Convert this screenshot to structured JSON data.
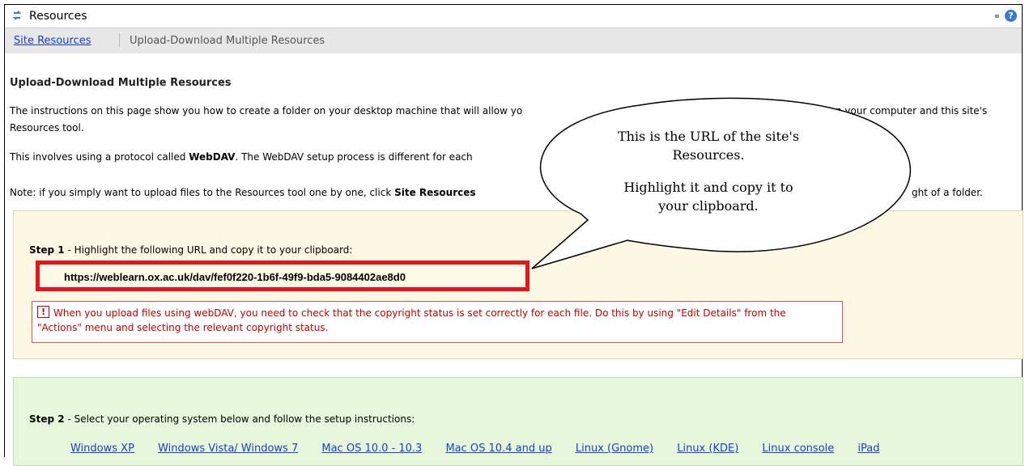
{
  "window": {
    "title": "Resources",
    "link_icon": "link-icon",
    "help_icon": "help-icon",
    "help_glyph": "?"
  },
  "nav": {
    "site_resources": "Site Resources",
    "current": "Upload-Download Multiple Resources"
  },
  "main": {
    "heading": "Upload-Download Multiple Resources",
    "p1_start": "The instructions on this page show you how to create a folder on your desktop machine that will allow yo",
    "p1_end": "n your computer and this site's",
    "p1_line2": "Resources tool.",
    "p2_prefix": "This involves using a protocol called ",
    "p2_bold": "WebDAV",
    "p2_rest": ". The WebDAV setup process is different for each",
    "p3_prefix": "Note: if you simply want to upload files to the Resources tool one by one, click ",
    "p3_bold": "Site Resources",
    "p3_end": "ght of a folder."
  },
  "step1": {
    "label_bold": "Step 1",
    "label_rest": " - Highlight the following URL and copy it to your clipboard:",
    "url": "https://weblearn.ox.ac.uk/dav/fef0f220-1b6f-49f9-bda5-9084402ae8d0",
    "warning_icon": "!",
    "warning": "When you upload files using webDAV, you need to check that the copyright status is set correctly for each file. Do this by using \"Edit Details\" from the \"Actions\" menu and selecting the relevant copyright status."
  },
  "step2": {
    "label_bold": "Step 2",
    "label_rest": " - Select your operating system below and follow the setup instructions:",
    "os_links": [
      "Windows XP",
      "Windows Vista/ Windows 7",
      "Mac OS 10.0 - 10.3",
      "Mac OS 10.4 and up",
      "Linux (Gnome)",
      "Linux (KDE)",
      "Linux console",
      "iPad"
    ]
  },
  "callout": {
    "line1": "This is the URL of the site's",
    "line2": "Resources.",
    "line3": "Highlight it and copy it to",
    "line4": "your clipboard."
  },
  "colors": {
    "accent_red": "#e8141b",
    "link_blue": "#1a3ec8",
    "step1_bg": "#fcf8e4",
    "step2_bg": "#e6f7dc"
  }
}
